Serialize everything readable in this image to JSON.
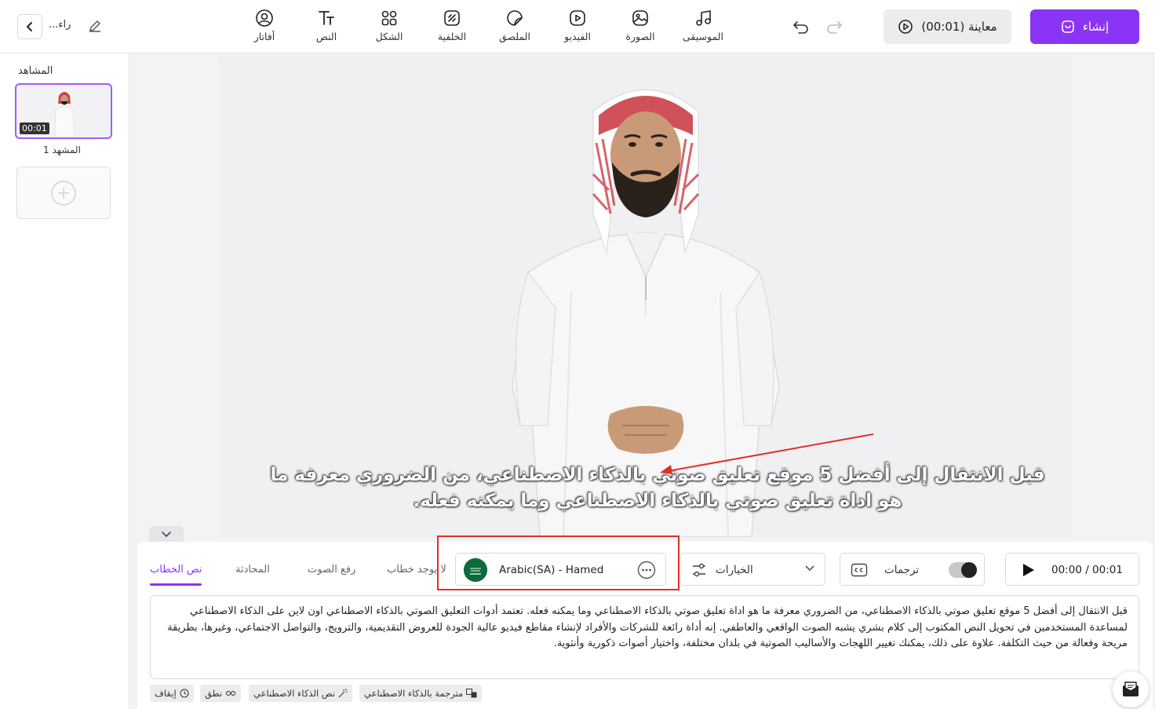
{
  "topbar": {
    "project_title": "...راء",
    "tools": [
      {
        "label": "أفاتار",
        "icon": "avatar-icon"
      },
      {
        "label": "النص",
        "icon": "text-icon"
      },
      {
        "label": "الشكل",
        "icon": "shape-icon"
      },
      {
        "label": "الخلفية",
        "icon": "background-icon"
      },
      {
        "label": "الملصق",
        "icon": "sticker-icon"
      },
      {
        "label": "الفيديو",
        "icon": "video-icon"
      },
      {
        "label": "الصورة",
        "icon": "image-icon"
      },
      {
        "label": "الموسيقى",
        "icon": "music-icon"
      }
    ],
    "preview_label": "معاينة (00:01)",
    "create_label": "إنشاء",
    "accent_color": "#8a34f5"
  },
  "scenes": {
    "title": "المشاهد",
    "items": [
      {
        "label": "المشهد 1",
        "duration": "00:01"
      }
    ]
  },
  "canvas": {
    "caption": "قبل الانتقال إلى أفضل 5 موقع تعليق صوتي بالذكاء الاصطناعي، من الضروري معرفة ما هو اداة تعليق صوتي بالذكاء الاصطناعي وما يمكنه فعله."
  },
  "editor": {
    "tabs": [
      "نص الخطاب",
      "المحادثة",
      "رفع الصوت",
      "لا يوجد خطاب"
    ],
    "voice": {
      "name": "Arabic(SA) - Hamed",
      "flag": "saudi-flag-icon"
    },
    "options_label": "الخيارات",
    "captions_label": "ترجمات",
    "captions_enabled": true,
    "player_time": "00:00 / 00:01",
    "script_text": "قبل الانتقال إلى أفضل 5 موقع تعليق صوتي بالذكاء الاصطناعي، من الضروري معرفة ما هو اداة تعليق صوتي بالذكاء الاصطناعي وما يمكنه فعله. تعتمد أدوات التعليق الصوتي بالذكاء الاصطناعي اون لاين على الذكاء الاصطناعي لمساعدة المستخدمين في تحويل النص المكتوب إلى كلام بشري يشبه الصوت الواقعي والعاطفي. إنه أداة رائعة للشركات والأفراد لإنشاء مقاطع فيديو عالية الجودة للعروض التقديمية، والترويج، والتواصل الاجتماعي، وغيرها، بطريقة مريحة وفعالة من حيث التكلفة. علاوة على ذلك، يمكنك تغيير اللهجات والأساليب الصوتية في بلدان مختلفة، واختيار أصوات ذكورية وأنثوية.",
    "chips": [
      "إيقاف",
      "نطق",
      "نص الذكاء الاصطناعي",
      "مترجمة بالذكاء الاصطناعي"
    ]
  }
}
